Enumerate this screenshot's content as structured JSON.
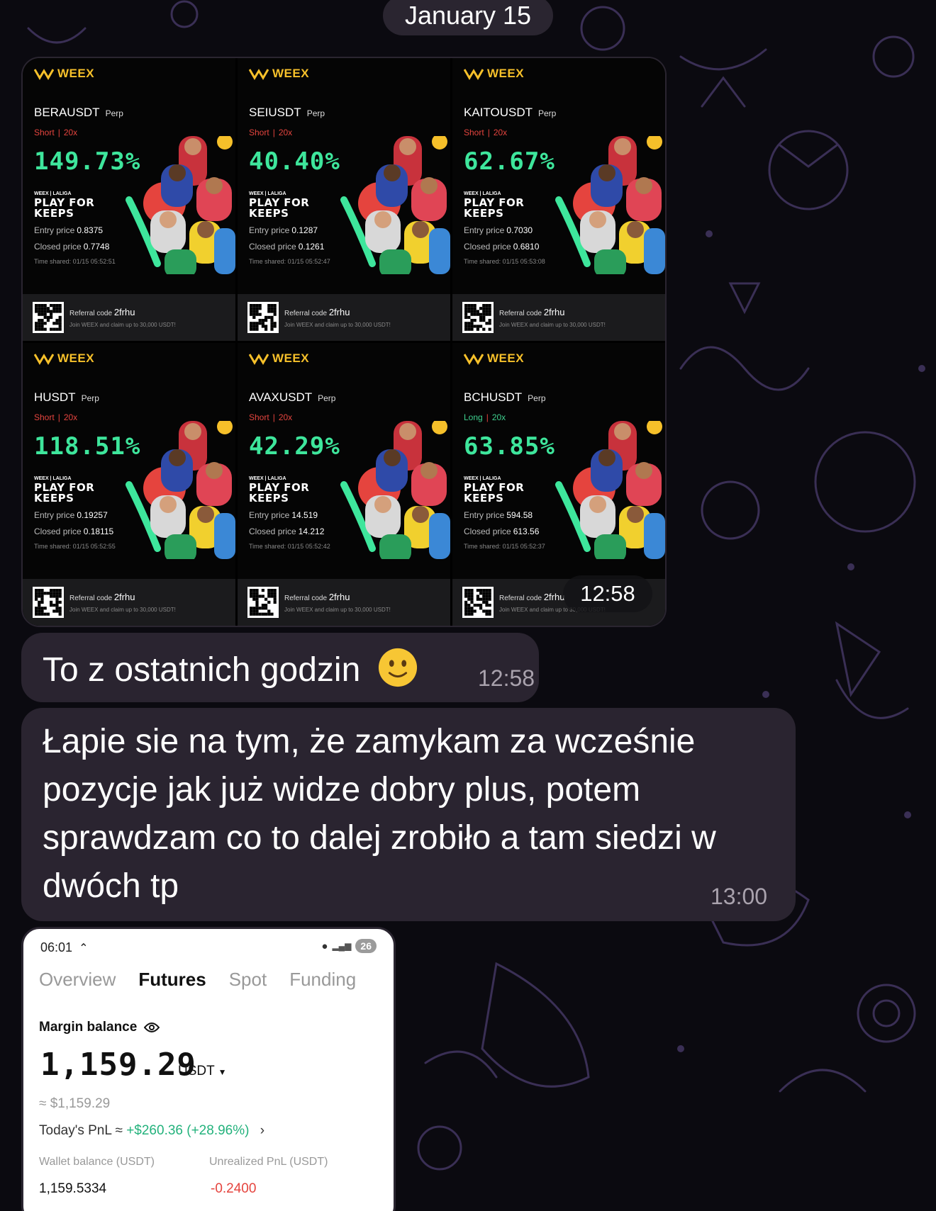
{
  "chat": {
    "date_label": "January 15",
    "photo_time": "12:58"
  },
  "brand": {
    "accent": "#f6c02a",
    "profit_color": "#3ee69c",
    "short_color": "#e5443e",
    "long_color": "#3ecf8e"
  },
  "cards": [
    {
      "logo": "WEEX",
      "pair": "BERAUSDT",
      "kind": "Perp",
      "side": "Short",
      "lev": "20x",
      "pnl": "149.73%",
      "promo_small": "WEEX | LALIGA",
      "promo_l1": "PLAY FOR",
      "promo_l2": "KEEPS",
      "entry_label": "Entry price",
      "entry": "0.8375",
      "closed_label": "Closed price",
      "closed": "0.7748",
      "time": "Time shared: 01/15 05:52:51",
      "ref_label": "Referral code",
      "ref": "2frhu",
      "join": "Join WEEX and claim up to 30,000 USDT!"
    },
    {
      "logo": "WEEX",
      "pair": "SEIUSDT",
      "kind": "Perp",
      "side": "Short",
      "lev": "20x",
      "pnl": "40.40%",
      "promo_small": "WEEX | LALIGA",
      "promo_l1": "PLAY FOR",
      "promo_l2": "KEEPS",
      "entry_label": "Entry price",
      "entry": "0.1287",
      "closed_label": "Closed price",
      "closed": "0.1261",
      "time": "Time shared: 01/15 05:52:47",
      "ref_label": "Referral code",
      "ref": "2frhu",
      "join": "Join WEEX and claim up to 30,000 USDT!"
    },
    {
      "logo": "WEEX",
      "pair": "KAITOUSDT",
      "kind": "Perp",
      "side": "Short",
      "lev": "20x",
      "pnl": "62.67%",
      "promo_small": "WEEX | LALIGA",
      "promo_l1": "PLAY FOR",
      "promo_l2": "KEEPS",
      "entry_label": "Entry price",
      "entry": "0.7030",
      "closed_label": "Closed price",
      "closed": "0.6810",
      "time": "Time shared: 01/15 05:53:08",
      "ref_label": "Referral code",
      "ref": "2frhu",
      "join": "Join WEEX and claim up to 30,000 USDT!"
    },
    {
      "logo": "WEEX",
      "pair": "HUSDT",
      "kind": "Perp",
      "side": "Short",
      "lev": "20x",
      "pnl": "118.51%",
      "promo_small": "WEEX | LALIGA",
      "promo_l1": "PLAY FOR",
      "promo_l2": "KEEPS",
      "entry_label": "Entry price",
      "entry": "0.19257",
      "closed_label": "Closed price",
      "closed": "0.18115",
      "time": "Time shared: 01/15 05:52:55",
      "ref_label": "Referral code",
      "ref": "2frhu",
      "join": "Join WEEX and claim up to 30,000 USDT!"
    },
    {
      "logo": "WEEX",
      "pair": "AVAXUSDT",
      "kind": "Perp",
      "side": "Short",
      "lev": "20x",
      "pnl": "42.29%",
      "promo_small": "WEEX | LALIGA",
      "promo_l1": "PLAY FOR",
      "promo_l2": "KEEPS",
      "entry_label": "Entry price",
      "entry": "14.519",
      "closed_label": "Closed price",
      "closed": "14.212",
      "time": "Time shared: 01/15 05:52:42",
      "ref_label": "Referral code",
      "ref": "2frhu",
      "join": "Join WEEX and claim up to 30,000 USDT!"
    },
    {
      "logo": "WEEX",
      "pair": "BCHUSDT",
      "kind": "Perp",
      "side": "Long",
      "lev": "20x",
      "pnl": "63.85%",
      "promo_small": "WEEX | LALIGA",
      "promo_l1": "PLAY FOR",
      "promo_l2": "KEEPS",
      "entry_label": "Entry price",
      "entry": "594.58",
      "closed_label": "Closed price",
      "closed": "613.56",
      "time": "Time shared: 01/15 05:52:37",
      "ref_label": "Referral code",
      "ref": "2frhu",
      "join": "Join WEEX and claim up to 30,000 USDT!"
    }
  ],
  "messages": [
    {
      "text": "To z ostatnich godzin",
      "emoji": "slightly-smiling-face-icon",
      "time": "12:58"
    },
    {
      "text": "Łapie sie na tym, że zamykam za wcześnie pozycje jak już widze dobry plus, potem sprawdzam co to dalej zrobiło a tam siedzi w dwóch tp",
      "time": "13:00"
    }
  ],
  "phone": {
    "status_time": "06:01",
    "battery": "26",
    "tabs": [
      "Overview",
      "Futures",
      "Spot",
      "Funding"
    ],
    "active_tab": "Futures",
    "margin_label": "Margin balance",
    "balance": "1,159.29",
    "currency": "USDT",
    "approx": "≈ $1,159.29",
    "pnl_label": "Today's PnL ≈",
    "pnl_value": "+$260.36 (+28.96%)",
    "wallet_label": "Wallet balance (USDT)",
    "wallet_value": "1,159.5334",
    "unrealized_label": "Unrealized PnL (USDT)",
    "unrealized_value": "-0.2400"
  }
}
